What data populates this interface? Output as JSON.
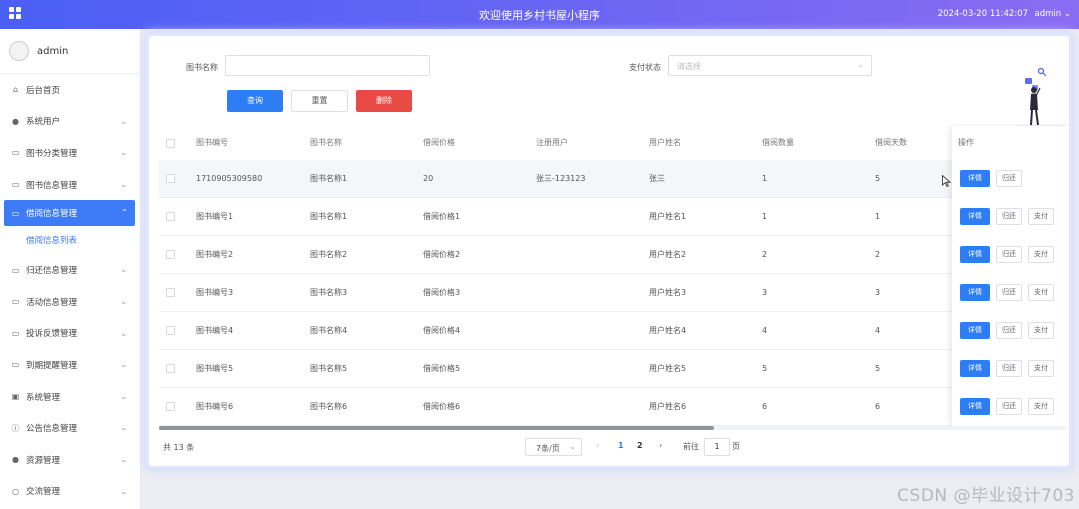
{
  "header": {
    "title": "欢迎使用乡村书屋小程序",
    "datetime": "2024-03-20 11:42:07",
    "user": "admin"
  },
  "sidebar": {
    "profile_name": "admin",
    "items": [
      {
        "label": "后台首页",
        "icon": "home-icon"
      },
      {
        "label": "系统用户",
        "icon": "user-icon"
      },
      {
        "label": "图书分类管理",
        "icon": "document-icon"
      },
      {
        "label": "图书信息管理",
        "icon": "document-icon"
      },
      {
        "label": "借阅信息管理",
        "icon": "document-icon",
        "active": true
      },
      {
        "label": "归还信息管理",
        "icon": "document-icon"
      },
      {
        "label": "活动信息管理",
        "icon": "document-icon"
      },
      {
        "label": "投诉反馈管理",
        "icon": "document-icon"
      },
      {
        "label": "到期提醒管理",
        "icon": "document-icon"
      },
      {
        "label": "系统管理",
        "icon": "image-icon"
      },
      {
        "label": "公告信息管理",
        "icon": "info-icon"
      },
      {
        "label": "资源管理",
        "icon": "location-icon"
      },
      {
        "label": "交流管理",
        "icon": "chat-icon"
      }
    ],
    "submenu": {
      "label": "借阅信息列表"
    }
  },
  "search": {
    "book_name_label": "图书名称",
    "book_name_value": "",
    "pay_status_label": "支付状态",
    "pay_status_placeholder": "请选择"
  },
  "buttons": {
    "query": "查询",
    "reset": "重置",
    "delete": "删除"
  },
  "table": {
    "columns": [
      "图书编号",
      "图书名称",
      "借阅价格",
      "注册用户",
      "用户姓名",
      "借阅数量",
      "借阅天数"
    ],
    "ops_header": "操作",
    "rows": [
      [
        "1710905309580",
        "图书名称1",
        "20",
        "张三-123123",
        "张三",
        "1",
        "5"
      ],
      [
        "图书编号1",
        "图书名称1",
        "借阅价格1",
        "",
        "用户姓名1",
        "1",
        "1"
      ],
      [
        "图书编号2",
        "图书名称2",
        "借阅价格2",
        "",
        "用户姓名2",
        "2",
        "2"
      ],
      [
        "图书编号3",
        "图书名称3",
        "借阅价格3",
        "",
        "用户姓名3",
        "3",
        "3"
      ],
      [
        "图书编号4",
        "图书名称4",
        "借阅价格4",
        "",
        "用户姓名4",
        "4",
        "4"
      ],
      [
        "图书编号5",
        "图书名称5",
        "借阅价格5",
        "",
        "用户姓名5",
        "5",
        "5"
      ],
      [
        "图书编号6",
        "图书名称6",
        "借阅价格6",
        "",
        "用户姓名6",
        "6",
        "6"
      ]
    ],
    "row_actions": {
      "detail": "详情",
      "return": "归还",
      "pay": "支付"
    },
    "first_row_has_pay": false
  },
  "pagination": {
    "total": "共 13 条",
    "page_size": "7条/页",
    "pages": [
      "1",
      "2"
    ],
    "current_page": "1",
    "goto_label": "前往",
    "goto_value": "1",
    "page_suffix": "页"
  },
  "watermark": "CSDN @毕业设计703",
  "colors": {
    "accent": "#2d7df5",
    "danger": "#e84b46",
    "header_gradient_start": "#4a5ff5",
    "header_gradient_end": "#8a6cf2"
  }
}
